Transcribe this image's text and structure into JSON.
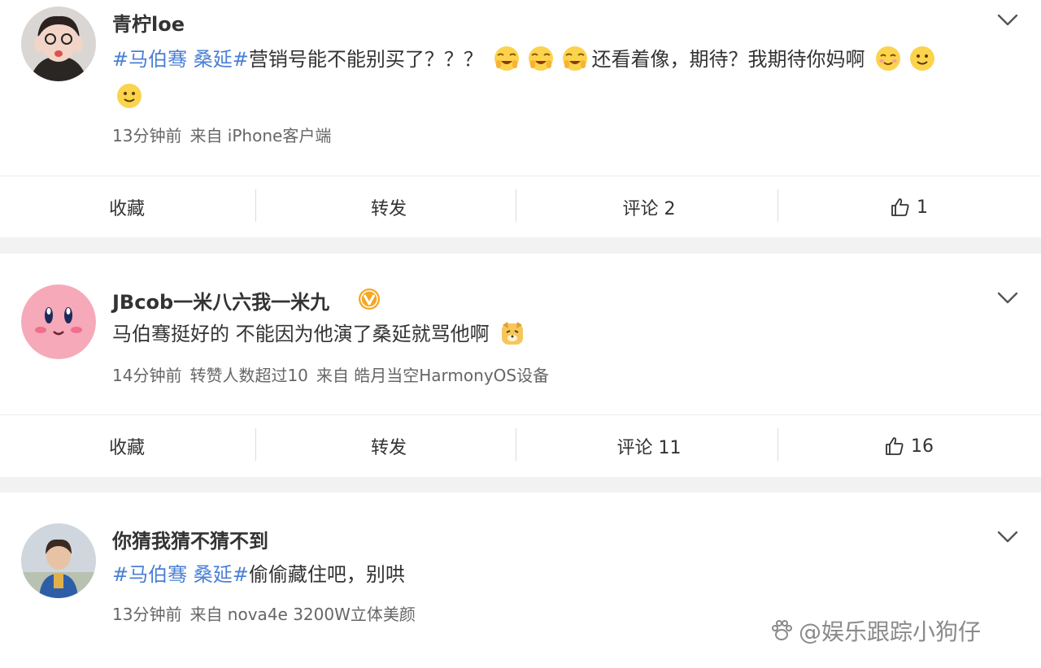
{
  "posts": [
    {
      "username": "青柠loe",
      "content": {
        "tag": "#马伯骞 桑延#",
        "text_a": "营销号能不能别买了？？？",
        "text_b": "还看着像，期待？我期待你妈啊"
      },
      "meta": {
        "time": "13分钟前",
        "source": "来自 iPhone客户端"
      },
      "actions": {
        "collect": "收藏",
        "repost": "转发",
        "comment": "评论 2",
        "like_count": "1"
      }
    },
    {
      "username": "JBcob一米八六我一米九",
      "verified": true,
      "content": {
        "text": "马伯骞挺好的 不能因为他演了桑延就骂他啊"
      },
      "meta": {
        "time": "14分钟前",
        "extra": "转赞人数超过10",
        "source": "来自 皓月当空HarmonyOS设备"
      },
      "actions": {
        "collect": "收藏",
        "repost": "转发",
        "comment": "评论 11",
        "like_count": "16"
      }
    },
    {
      "username": "你猜我猜不猜不到",
      "content": {
        "tag": "#马伯骞 桑延#",
        "text": "偷偷藏住吧，别哄"
      },
      "meta": {
        "time": "13分钟前",
        "source": "来自 nova4e 3200W立体美颜"
      }
    }
  ],
  "watermark": "@娱乐跟踪小狗仔",
  "colors": {
    "tag": "#4a7fd6",
    "verified": "#f5a623",
    "page_bg": "#f2f2f2"
  }
}
